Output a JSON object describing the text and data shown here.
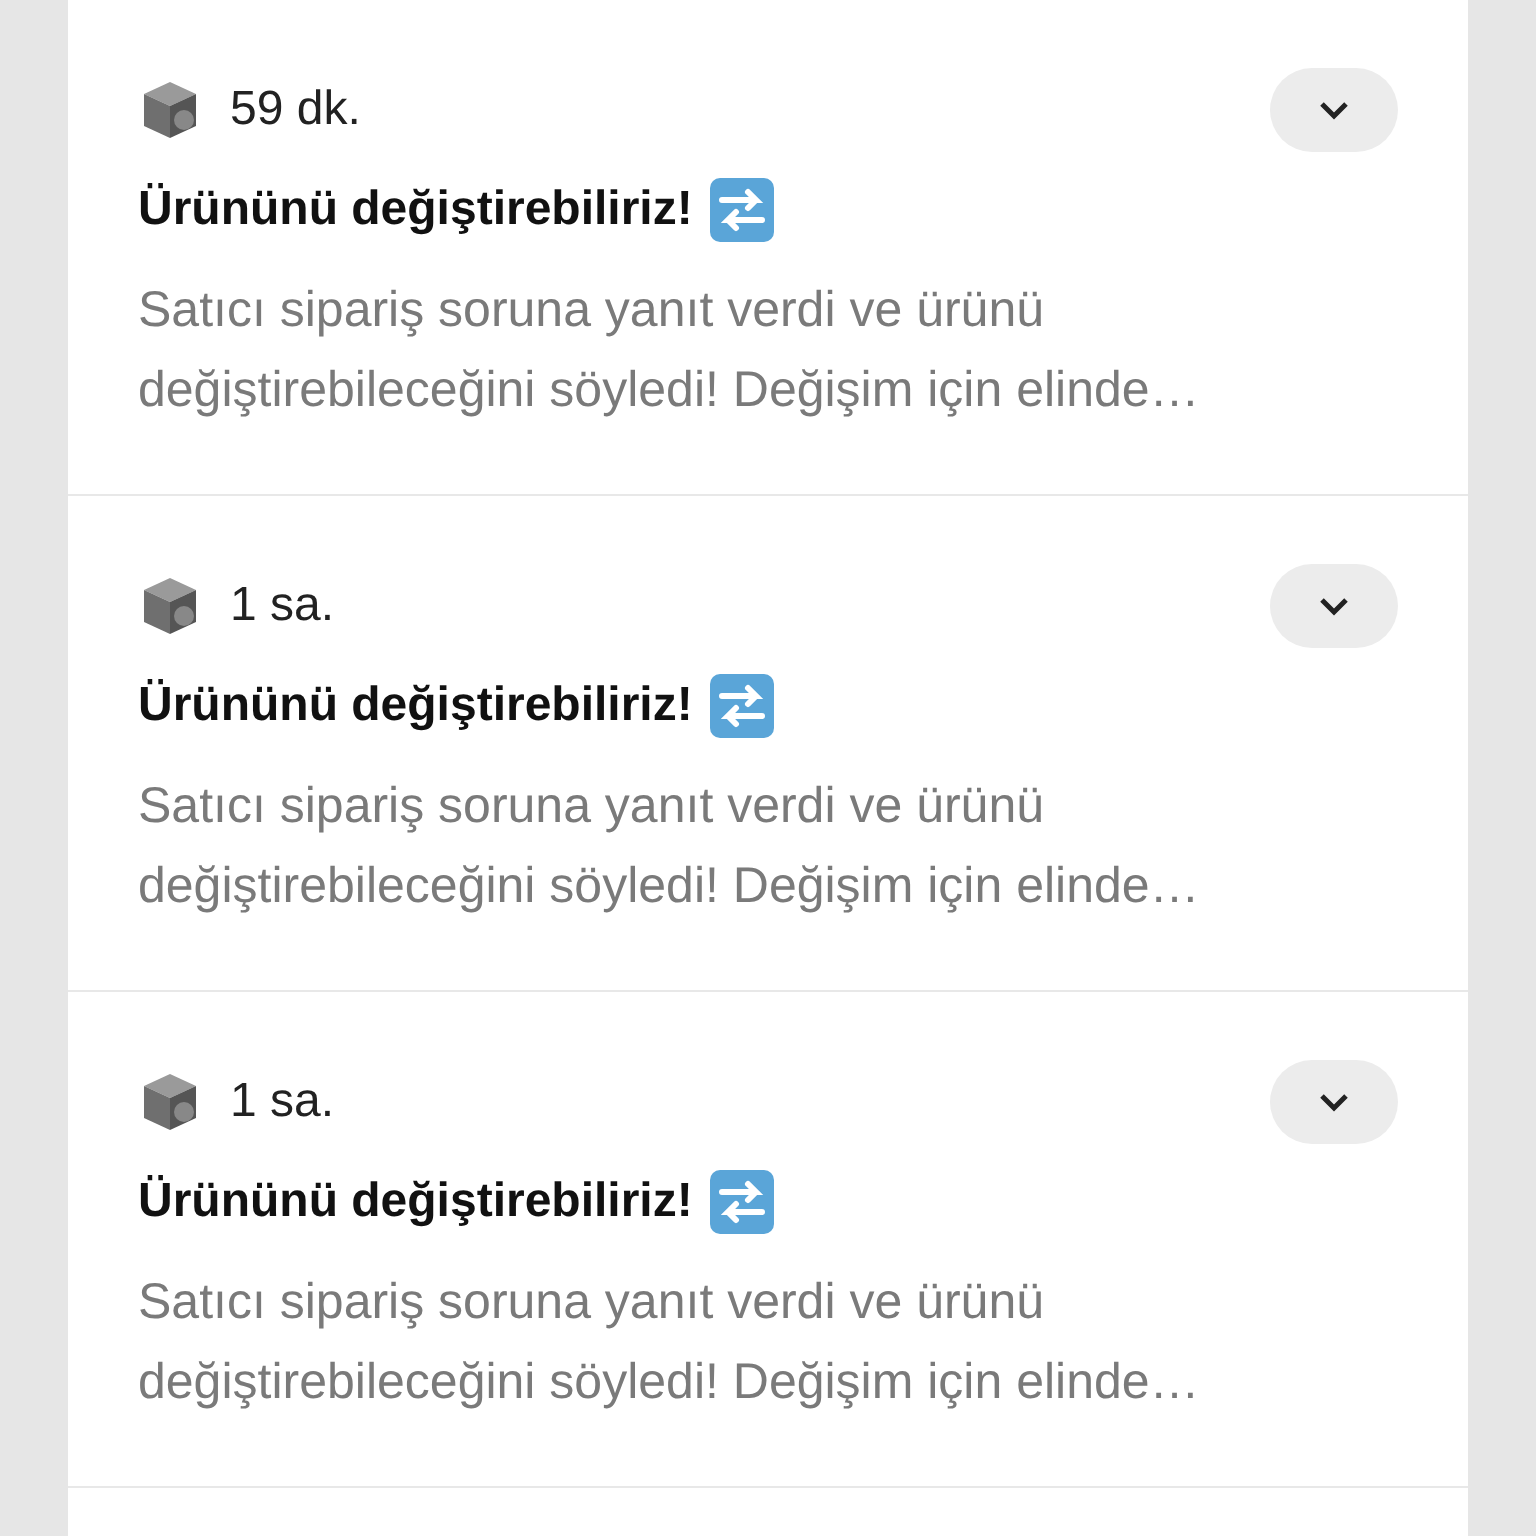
{
  "notifications": [
    {
      "time": "59 dk.",
      "title": "Ürününü değiştirebiliriz!",
      "body": "Satıcı sipariş soruna yanıt verdi ve ürünü değiştirebileceğini söyledi! Değişim için elinde…",
      "expanded": false
    },
    {
      "time": "1 sa.",
      "title": "Ürününü değiştirebiliriz!",
      "body": "Satıcı sipariş soruna yanıt verdi ve ürünü değiştirebileceğini söyledi! Değişim için elinde…",
      "expanded": false
    },
    {
      "time": "1 sa.",
      "title": "Ürününü değiştirebiliriz!",
      "body": "Satıcı sipariş soruna yanıt verdi ve ürünü değiştirebileceğini söyledi! Değişim için elinde…",
      "expanded": false
    }
  ]
}
